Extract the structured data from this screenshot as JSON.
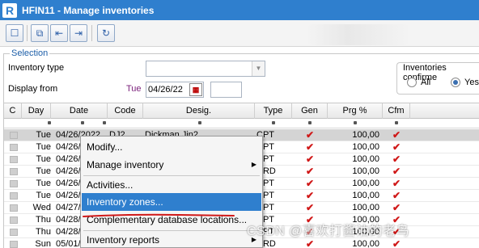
{
  "window": {
    "title": "HFIN11 - Manage inventories",
    "logo_letter": "R"
  },
  "toolbar": {
    "buttons": [
      {
        "name": "new-document-button",
        "glyph": "☐"
      },
      {
        "name": "copy-button",
        "glyph": "⧉"
      },
      {
        "name": "transfer-left-button",
        "glyph": "⇤"
      },
      {
        "name": "transfer-right-button",
        "glyph": "⇥"
      },
      {
        "name": "refresh-button",
        "glyph": "↻"
      }
    ]
  },
  "selection": {
    "legend": "Selection",
    "inventory_type_label": "Inventory type",
    "inventory_type_value": "",
    "display_from_label": "Display from",
    "display_from_day": "Tue",
    "display_from_date": "04/26/22",
    "confirmed": {
      "legend": "Inventories confirme",
      "options": [
        "All",
        "Yes"
      ],
      "selected": "Yes"
    }
  },
  "grid": {
    "columns": [
      "C",
      "Day",
      "Date",
      "Code",
      "Desig.",
      "Type",
      "Gen",
      "Prg %",
      "Cfm"
    ],
    "rows": [
      {
        "day": "Tue",
        "date": "04/26/2022",
        "code": "DJ2",
        "desig": "Dickman  Jin2",
        "type": "CPT",
        "gen": true,
        "prg": "100,00",
        "cfm": true,
        "selected": true
      },
      {
        "day": "Tue",
        "date": "04/26/",
        "code": "",
        "desig": "",
        "type": "CPT",
        "gen": true,
        "prg": "100,00",
        "cfm": true,
        "selected": false
      },
      {
        "day": "Tue",
        "date": "04/26/",
        "code": "",
        "desig": "",
        "type": "CPT",
        "gen": true,
        "prg": "100,00",
        "cfm": true,
        "selected": false
      },
      {
        "day": "Tue",
        "date": "04/26/",
        "code": "",
        "desig": "",
        "type": "CRD",
        "gen": true,
        "prg": "100,00",
        "cfm": true,
        "selected": false
      },
      {
        "day": "Tue",
        "date": "04/26/",
        "code": "",
        "desig": "",
        "type": "CPT",
        "gen": true,
        "prg": "100,00",
        "cfm": true,
        "selected": false
      },
      {
        "day": "Tue",
        "date": "04/26/",
        "code": "",
        "desig": "",
        "type": "CPT",
        "gen": true,
        "prg": "100,00",
        "cfm": true,
        "selected": false
      },
      {
        "day": "Wed",
        "date": "04/27/",
        "code": "",
        "desig": "",
        "type": "CPT",
        "gen": true,
        "prg": "100,00",
        "cfm": true,
        "selected": false
      },
      {
        "day": "Thu",
        "date": "04/28/",
        "code": "",
        "desig": "",
        "type": "CPT",
        "gen": true,
        "prg": "100,00",
        "cfm": true,
        "selected": false
      },
      {
        "day": "Thu",
        "date": "04/28/",
        "code": "",
        "desig": "",
        "type": "CPT",
        "gen": true,
        "prg": "100,00",
        "cfm": true,
        "selected": false
      },
      {
        "day": "Sun",
        "date": "05/01/",
        "code": "",
        "desig": "",
        "type": "CRD",
        "gen": true,
        "prg": "100,00",
        "cfm": true,
        "selected": false
      }
    ]
  },
  "context_menu": {
    "items": [
      {
        "label": "Modify...",
        "submenu": false,
        "active": false
      },
      {
        "label": "Manage inventory",
        "submenu": true,
        "active": false
      },
      {
        "label": "Activities...",
        "submenu": false,
        "active": false
      },
      {
        "label": "Inventory zones...",
        "submenu": false,
        "active": true
      },
      {
        "label": "Complementary database locations...",
        "submenu": false,
        "active": false
      },
      {
        "label": "Inventory reports",
        "submenu": true,
        "active": false
      }
    ]
  },
  "watermark": "CSDN @喜欢打酱油的老鸟",
  "colors": {
    "title_bar": "#2f7fce",
    "menu_highlight": "#2f7fce",
    "check_mark": "#d01818",
    "annotation_underline": "#d01818"
  }
}
